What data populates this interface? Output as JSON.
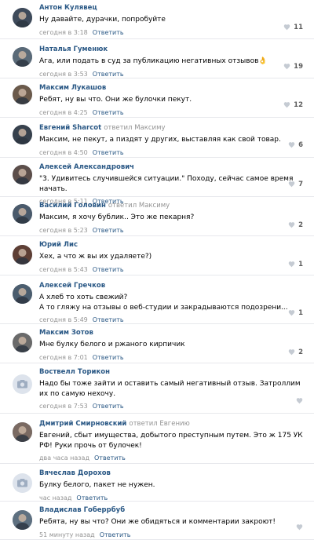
{
  "reply_label": "Ответить",
  "answered_word": "ответил",
  "comments": [
    {
      "author": "Антон Кулявец",
      "reply_to": "",
      "text": "Ну давайте, дурачки, попробуйте",
      "time": "сегодня в 3:18",
      "likes": "11",
      "avatar": "photo"
    },
    {
      "author": "Наталья Гуменюк",
      "reply_to": "",
      "text": "Ага, или подать в суд за публикацию негативных отзывов👌",
      "time": "сегодня в 3:53",
      "likes": "19",
      "avatar": "photo"
    },
    {
      "author": "Максим Лукашов",
      "reply_to": "",
      "text": "Ребят, ну вы что. Они же булочки пекут.",
      "time": "сегодня в 4:25",
      "likes": "12",
      "avatar": "photo"
    },
    {
      "author": "Евгений Sharcot",
      "reply_to": "Максиму",
      "text": "Максим, не пекут, а пиздят у других, выставляя как свой товар.",
      "time": "сегодня в 4:50",
      "likes": "6",
      "avatar": "photo"
    },
    {
      "author": "Алексей Александрович",
      "reply_to": "",
      "text": "\"3. Удивитесь случившейся ситуации.\" Походу, сейчас самое время начать.",
      "time": "сегодня в 5:11",
      "likes": "7",
      "avatar": "photo"
    },
    {
      "author": "Василий Головин",
      "reply_to": "Максиму",
      "text": "Максим, я хочу бублик.. Это же пекарня?",
      "time": "сегодня в 5:23",
      "likes": "2",
      "avatar": "photo"
    },
    {
      "author": "Юрий Лис",
      "reply_to": "",
      "text": "Хех, а что ж вы их удаляете?)",
      "time": "сегодня в 5:43",
      "likes": "1",
      "avatar": "photo"
    },
    {
      "author": "Алексей Гречков",
      "reply_to": "",
      "text": "А хлеб то хоть свежий?\nА то гляжу на отзывы о веб-студии и закрадываются подозрени...",
      "time": "сегодня в 5:49",
      "likes": "1",
      "avatar": "photo"
    },
    {
      "author": "Максим Зотов",
      "reply_to": "",
      "text": "Мне булку белого и ржаного кирпичик",
      "time": "сегодня в 7:01",
      "likes": "2",
      "avatar": "photo"
    },
    {
      "author": "Воствелл Торикон",
      "reply_to": "",
      "text": "Надо бы тоже зайти и оставить самый негативный отзыв. Затроллим их по самую нехочу.",
      "time": "сегодня в 7:53",
      "likes": "",
      "avatar": "camera"
    },
    {
      "author": "Дмитрий Смирновский",
      "reply_to": "Евгению",
      "text": "Евгений, сбыт имущества, добытого преступным путем. Это ж 175 УК РФ! Руки прочь от булочек!",
      "time": "два часа назад",
      "likes": "",
      "avatar": "photo"
    },
    {
      "author": "Вячеслав Дорохов",
      "reply_to": "",
      "text": "Булку белого, пакет не нужен.",
      "time": "час назад",
      "likes": "",
      "avatar": "camera"
    },
    {
      "author": "Владислав Гоберрбуб",
      "reply_to": "",
      "text": "Ребята, ну вы что? Они же обидяться и комментарии закроют!",
      "time": "51 минуту назад",
      "likes": "",
      "avatar": "photo"
    }
  ]
}
